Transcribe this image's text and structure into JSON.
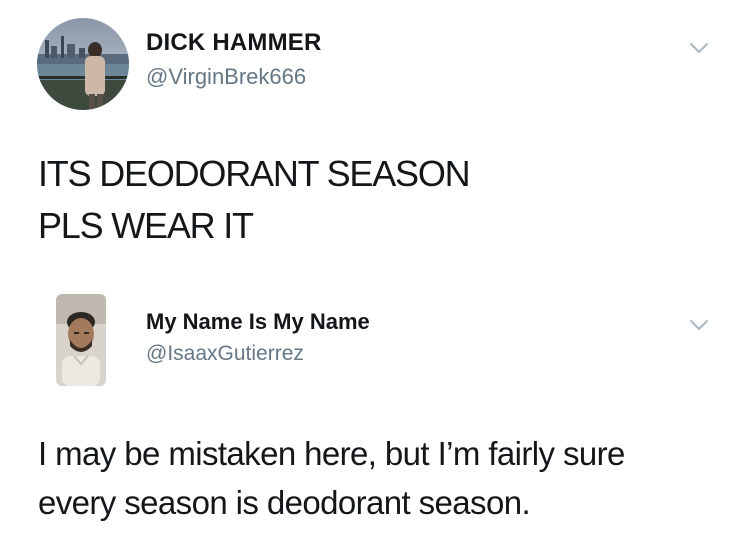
{
  "tweets": [
    {
      "display_name": "DICK HAMMER",
      "handle": "@VirginBrek666",
      "avatar_icon": "profile-photo",
      "menu_icon": "chevron-down-icon",
      "text_lines": [
        "ITS DEODORANT SEASON",
        "PLS WEAR IT"
      ]
    },
    {
      "display_name": "My Name Is My Name",
      "handle": "@IsaaxGutierrez",
      "avatar_icon": "profile-photo",
      "menu_icon": "chevron-down-icon",
      "text_lines": [
        "I may be mistaken here, but I’m fairly sure",
        "every season is deodorant season."
      ]
    }
  ],
  "colors": {
    "text": "#14171a",
    "secondary_text": "#657786",
    "chevron": "#aab8c2",
    "background": "#ffffff"
  }
}
